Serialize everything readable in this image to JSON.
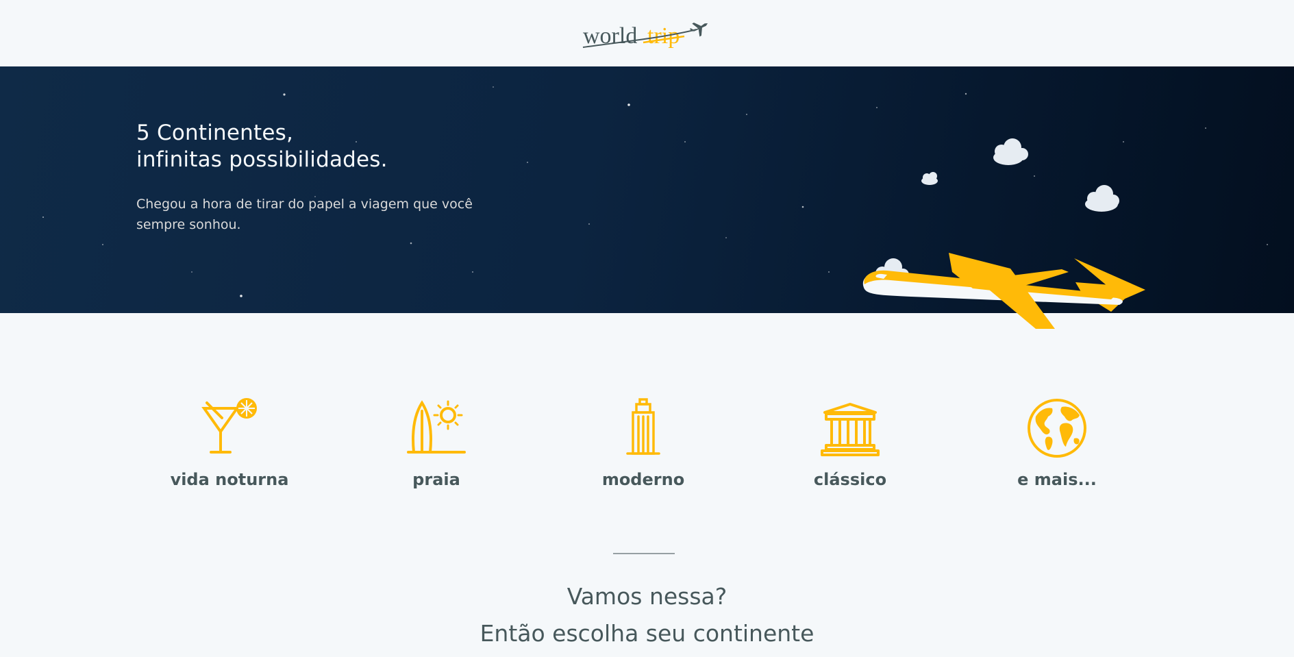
{
  "header": {
    "logo_word_1": "world",
    "logo_word_2": "trip",
    "logo_icon": "airplane-icon"
  },
  "banner": {
    "title_line_1": "5 Continentes,",
    "title_line_2": "infinitas possibilidades.",
    "subtitle": "Chegou a hora de tirar do papel a viagem que você sempre sonhou.",
    "illustration": "airplane-with-clouds"
  },
  "travel_types": [
    {
      "label": "vida noturna",
      "icon": "cocktail-icon"
    },
    {
      "label": "praia",
      "icon": "surfboard-sun-icon"
    },
    {
      "label": "moderno",
      "icon": "skyscraper-icon"
    },
    {
      "label": "clássico",
      "icon": "classic-building-icon"
    },
    {
      "label": "e mais...",
      "icon": "globe-icon"
    }
  ],
  "cta": {
    "line_1": "Vamos nessa?",
    "line_2": "Então escolha seu continente"
  },
  "colors": {
    "highlight": "#FFBA08",
    "dark_text": "#47585B",
    "light": "#F5F8FA",
    "banner_dark": "#0C2440"
  }
}
